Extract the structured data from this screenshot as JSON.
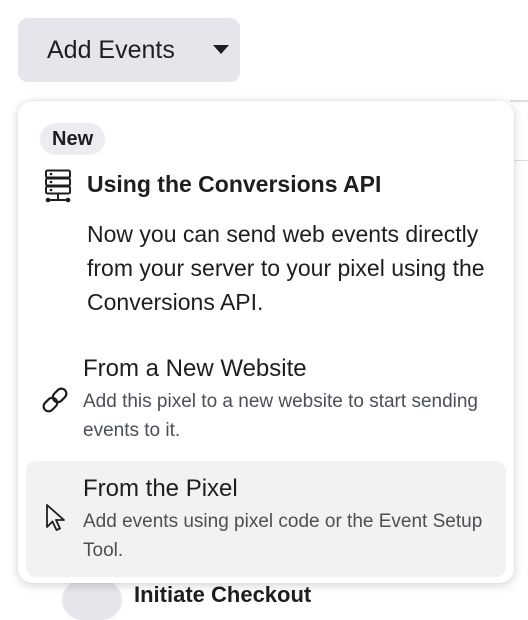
{
  "add_events_button": {
    "label": "Add Events"
  },
  "menu": {
    "badge": "New",
    "api": {
      "title": "Using the Conversions API",
      "description": "Now you can send web events directly from your server to your pixel using the Conversions API."
    },
    "options": [
      {
        "title": "From a New Website",
        "description": "Add this pixel to a new website to start sending events to it.",
        "icon": "link-icon"
      },
      {
        "title": "From the Pixel",
        "description": "Add events using pixel code or the Event Setup Tool.",
        "icon": "cursor-icon"
      }
    ]
  },
  "background": {
    "partial_event_name": "Initiate Checkout"
  },
  "colors": {
    "button_bg": "#e4e6eb",
    "hover_bg": "#f2f2f2",
    "text": "#1c1e21"
  }
}
